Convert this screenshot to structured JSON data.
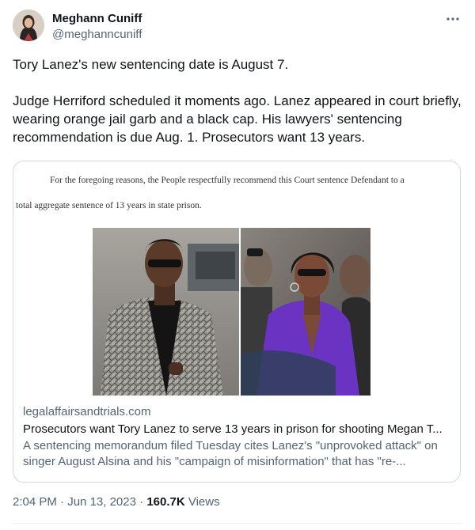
{
  "author": {
    "display_name": "Meghann Cuniff",
    "handle": "@meghanncuniff",
    "more_icon": "ellipsis-icon"
  },
  "tweet": {
    "paragraphs": [
      "Tory Lanez's new sentencing date is August 7.",
      "Judge Herriford scheduled it moments ago. Lanez appeared in court briefly, wearing orange jail garb and a black cap. His lawyers' sentencing recommendation is due Aug. 1. Prosecutors want 13 years."
    ]
  },
  "card": {
    "document_lines": [
      "For the foregoing reasons, the People respectfully recommend this Court sentence Defendant to a",
      "total aggregate sentence of 13 years in state prison."
    ],
    "domain": "legalaffairsandtrials.com",
    "title": "Prosecutors want Tory Lanez to serve 13 years in prison for shooting Megan T...",
    "description": "A sentencing memorandum filed Tuesday cites Lanez's \"unprovoked attack\" on singer August Alsina and his \"campaign of misinformation\" that has \"re-..."
  },
  "meta": {
    "time": "2:04 PM",
    "separator": "·",
    "date": "Jun 13, 2023",
    "views_count": "160.7K",
    "views_label": "Views"
  },
  "colors": {
    "text_primary": "#0f1419",
    "text_secondary": "#536471",
    "border": "#cfd9de",
    "suit_purple": "#6a33c2"
  }
}
